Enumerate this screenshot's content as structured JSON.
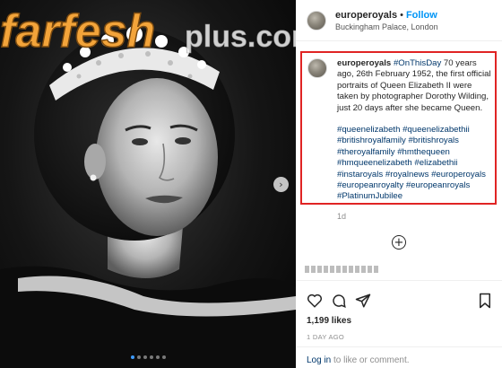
{
  "post": {
    "username": "europeroyals",
    "separator": "•",
    "follow_label": "Follow",
    "location": "Buckingham Palace, London"
  },
  "caption": {
    "username": "europeroyals",
    "hashtag_lead": "#OnThisDay",
    "text": " 70 years ago, 26th February 1952, the first official portraits of Queen Elizabeth II were taken by photographer Dorothy Wilding, just 20 days after she became Queen.",
    "hashtags": [
      "#queenelizabeth",
      "#queenelizabethii",
      "#britishroyalfamily",
      "#britishroyals",
      "#theroyalfamily",
      "#hmthequeen",
      "#hmqueenelizabeth",
      "#elizabethii",
      "#instaroyals",
      "#royalnews",
      "#europeroyals",
      "#europeanroyalty",
      "#europeanroyals",
      "#PlatinumJubilee"
    ],
    "time_ago": "1d"
  },
  "add_comment_icon": "plus-circle-icon",
  "stats": {
    "likes": "1,199 likes",
    "date": "1 DAY AGO"
  },
  "footer": {
    "login_link": "Log in",
    "rest": " to like or comment."
  },
  "carousel": {
    "next_icon": "chevron-right-icon",
    "slide_count": 6,
    "active_index": 0
  },
  "watermark": {
    "brand": "farfesh",
    "suffix": "plus.com"
  },
  "colors": {
    "accent": "#0095f6",
    "link": "#00376b",
    "highlight_border": "#e02424",
    "watermark_orange": "#f3a43a"
  },
  "icons": [
    "heart-icon",
    "comment-icon",
    "share-icon",
    "bookmark-icon"
  ]
}
